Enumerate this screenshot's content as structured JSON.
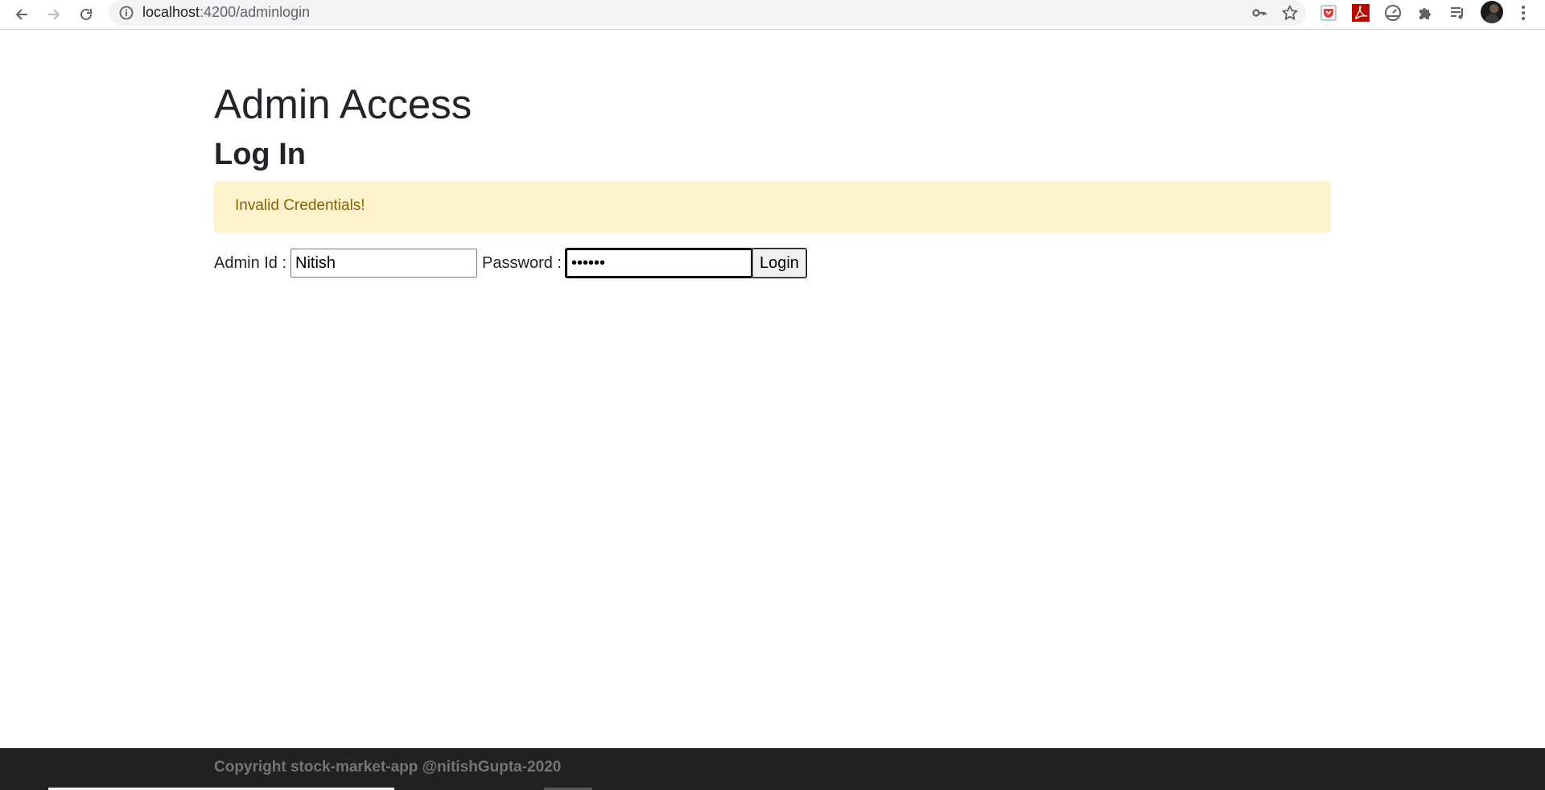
{
  "browser": {
    "url_host": "localhost",
    "url_rest": ":4200/adminlogin",
    "icons": {
      "back": "arrow-left-icon",
      "forward": "arrow-right-icon",
      "reload": "reload-icon",
      "site_info": "info-icon",
      "key": "key-icon",
      "bookmark": "star-icon",
      "extensions": [
        "pocket-icon",
        "acrobat-icon",
        "dashboard-icon",
        "puzzle-icon",
        "media-queue-icon"
      ],
      "menu": "kebab-menu-icon"
    }
  },
  "page": {
    "title": "Admin Access",
    "subtitle": "Log In",
    "alert": "Invalid Credentials!",
    "form": {
      "admin_id_label": "Admin Id :",
      "admin_id_value": "Nitish",
      "password_label": "Password :",
      "password_value": "••••••",
      "login_button": "Login"
    }
  },
  "footer": {
    "copyright": "Copyright stock-market-app @nitishGupta-2020"
  },
  "colors": {
    "alert_bg": "#fff3cd",
    "alert_text": "#856404",
    "footer_bg": "#212121",
    "footer_text": "#757575"
  }
}
